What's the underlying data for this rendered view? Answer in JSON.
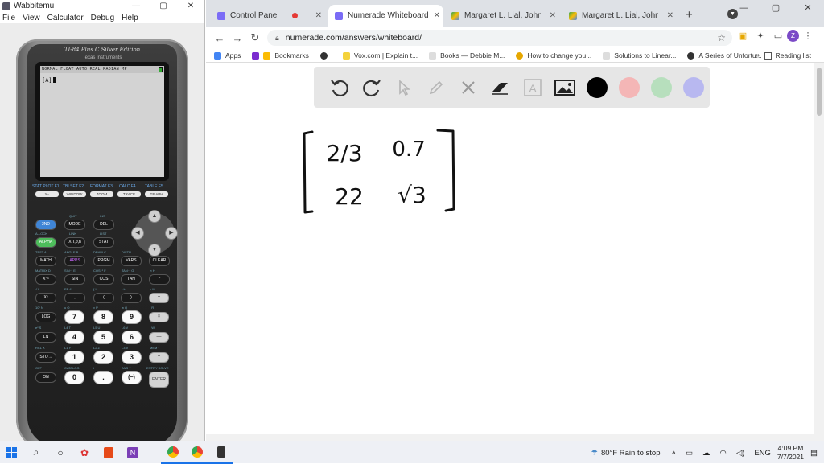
{
  "wabbitemu": {
    "title": "Wabbitemu",
    "controls": [
      "—",
      "▢",
      "✕"
    ],
    "menu": [
      "File",
      "View",
      "Calculator",
      "Debug",
      "Help"
    ],
    "calculator": {
      "brand": "TI-84 Plus C Silver Edition",
      "maker": "Texas Instruments",
      "status_bar": "NORMAL FLOAT AUTO REAL RADIAN MP",
      "screen_line": "[A]",
      "function_labels": [
        "STAT PLOT F1",
        "TBLSET F2",
        "FORMAT F3",
        "CALC F4",
        "TABLE F5"
      ],
      "function_keys": [
        "Y=",
        "WINDOW",
        "ZOOM",
        "TRACE",
        "GRAPH"
      ],
      "keys": {
        "second": "2ND",
        "mode": "MODE",
        "del": "DEL",
        "alpha": "ALPHA",
        "xton": "X,T,θ,n",
        "stat": "STAT",
        "math": "MATH",
        "apps": "APPS",
        "prgm": "PRGM",
        "vars": "VARS",
        "clear": "CLEAR",
        "inv": "X⁻¹",
        "sin": "SIN",
        "cos": "COS",
        "tan": "TAN",
        "pow": "^",
        "sq": "X²",
        "comma": ",",
        "lparen": "(",
        "rparen": ")",
        "div": "÷",
        "log": "LOG",
        "seven": "7",
        "eight": "8",
        "nine": "9",
        "mul": "×",
        "ln": "LN",
        "four": "4",
        "five": "5",
        "six": "6",
        "minus": "—",
        "sto": "STO→",
        "one": "1",
        "two": "2",
        "three": "3",
        "plus": "+",
        "on": "ON",
        "zero": "0",
        "dot": ".",
        "neg": "(−)",
        "enter": "ENTER"
      },
      "sublabels": {
        "quit": "QUIT",
        "ins": "INS",
        "alock": "A-LOCK",
        "link": "LINK",
        "list": "LIST",
        "test": "TEST A",
        "angle": "ANGLE B",
        "draw": "DRAW C",
        "distr": "DISTR",
        "matrix": "MATRIX D",
        "sinv": "SIN⁻¹ E",
        "cosv": "COS⁻¹ F",
        "tanv": "TAN⁻¹ G",
        "pi": "π H",
        "sqrt": "√ I",
        "ee": "EE J",
        "lbrace": "{ K",
        "rbrace": "} L",
        "e": "e M",
        "ten": "10ˣ N",
        "u": "u O",
        "v": "v P",
        "w": "w Q",
        "lbrack": "[ R",
        "ex": "eˣ S",
        "l4": "L4 T",
        "l5": "L5 U",
        "l6": "L6 V",
        "rbrack": "] W",
        "rcl": "RCL X",
        "l1": "L1 Y",
        "l2": "L2 Z",
        "l3": "L3 θ",
        "mem": "MEM \"",
        "off": "OFF",
        "catalog": "CATALOG",
        "i": "i",
        "ans": "ANS ?",
        "entry": "ENTRY SOLVE"
      }
    }
  },
  "chrome": {
    "tabs": [
      {
        "title": "Control Panel",
        "active": false,
        "color": "#7b6cf6"
      },
      {
        "title": "Numerade Whiteboard",
        "active": true,
        "color": "#7b6cf6"
      },
      {
        "title": "Margaret L. Lial, John Hornsby",
        "active": false,
        "color": "#fbbc04"
      },
      {
        "title": "Margaret L. Lial, John Hornsby",
        "active": false,
        "color": "#fbbc04"
      }
    ],
    "new_tab": "+",
    "window_controls": [
      "—",
      "▢",
      "✕"
    ],
    "url": "numerade.com/answers/whiteboard/",
    "bookmarks": [
      {
        "label": "Apps",
        "color": "#4285f4"
      },
      {
        "label": "Bookmarks",
        "color": "#7b2ccf"
      },
      {
        "label": "",
        "color": "#333333"
      },
      {
        "label": "Vox.com | Explain t...",
        "color": "#f4d23c"
      },
      {
        "label": "Books — Debbie M...",
        "color": "#dddddd"
      },
      {
        "label": "How to change you...",
        "color": "#e6a700"
      },
      {
        "label": "Solutions to Linear...",
        "color": "#dddddd"
      },
      {
        "label": "A Series of Unfortu...",
        "color": "#333333"
      }
    ],
    "bookmarks_more": "»",
    "reading_list": "Reading list",
    "profile_initial": "Z"
  },
  "whiteboard": {
    "tools": [
      "undo-icon",
      "redo-icon",
      "pointer-icon",
      "pen-icon",
      "tools-icon",
      "eraser-icon",
      "text-icon",
      "image-icon"
    ],
    "colors": [
      "#000000",
      "#f4b6b6",
      "#b7dfbd",
      "#b8b8f0"
    ],
    "matrix": {
      "a11": "2/3",
      "a12": "0.7",
      "a21": "22",
      "a22": "√3"
    }
  },
  "taskbar": {
    "weather": "80°F  Rain to stop",
    "language": "ENG",
    "time": "4:09 PM",
    "date": "7/7/2021"
  }
}
